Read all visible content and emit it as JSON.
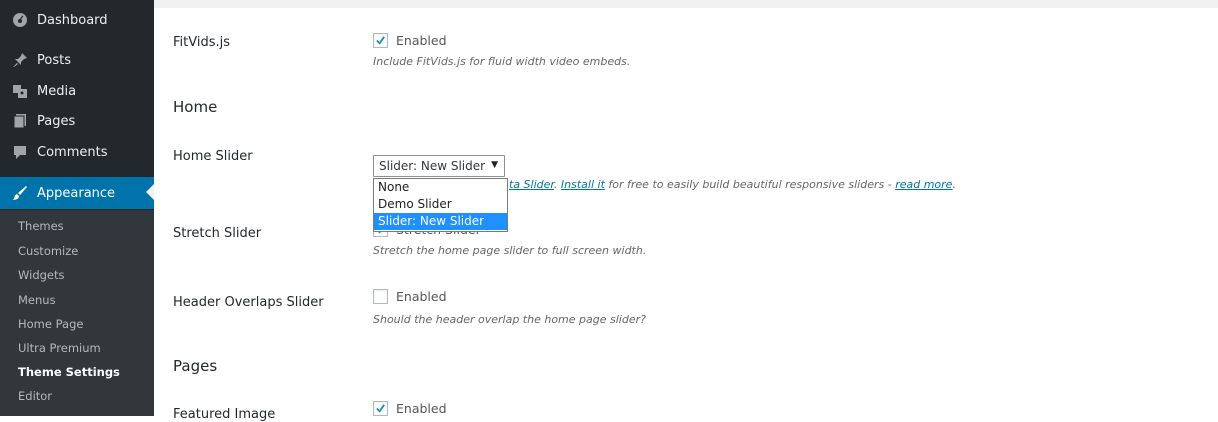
{
  "sidebar": {
    "menu": [
      {
        "label": "Dashboard",
        "icon": "dashboard-icon"
      },
      {
        "label": "Posts",
        "icon": "pin-icon"
      },
      {
        "label": "Media",
        "icon": "media-icon"
      },
      {
        "label": "Pages",
        "icon": "pages-icon"
      },
      {
        "label": "Comments",
        "icon": "comments-icon"
      },
      {
        "label": "Appearance",
        "icon": "brush-icon",
        "active": true
      }
    ],
    "submenu": [
      "Themes",
      "Customize",
      "Widgets",
      "Menus",
      "Home Page",
      "Ultra Premium",
      "Theme Settings",
      "Editor"
    ],
    "current_submenu": "Theme Settings",
    "colors": {
      "bg": "#23282d",
      "active": "#0073aa",
      "submenu_bg": "#32373c"
    }
  },
  "settings": {
    "fitvids": {
      "label": "FitVids.js",
      "checkbox_label": "Enabled",
      "checked": true,
      "description": "Include FitVids.js for fluid width video embeds."
    },
    "home_section": "Home",
    "home_slider": {
      "label": "Home Slider",
      "selected": "Slider: New Slider",
      "options": [
        "None",
        "Demo Slider",
        "Slider: New Slider"
      ],
      "desc_link1": "ta Slider",
      "desc_sep": ". ",
      "desc_link2": "Install it",
      "desc_mid": " for free to easily build beautiful responsive sliders - ",
      "desc_link3": "read more",
      "desc_end": "."
    },
    "stretch_slider": {
      "label": "Stretch Slider",
      "checkbox_label": "Stretch Slider",
      "checked": true,
      "description": "Stretch the home page slider to full screen width."
    },
    "header_overlaps": {
      "label": "Header Overlaps Slider",
      "checkbox_label": "Enabled",
      "checked": false,
      "description": "Should the header overlap the home page slider?"
    },
    "pages_section": "Pages",
    "featured_image": {
      "label": "Featured Image",
      "checkbox_label": "Enabled",
      "checked": true
    }
  }
}
